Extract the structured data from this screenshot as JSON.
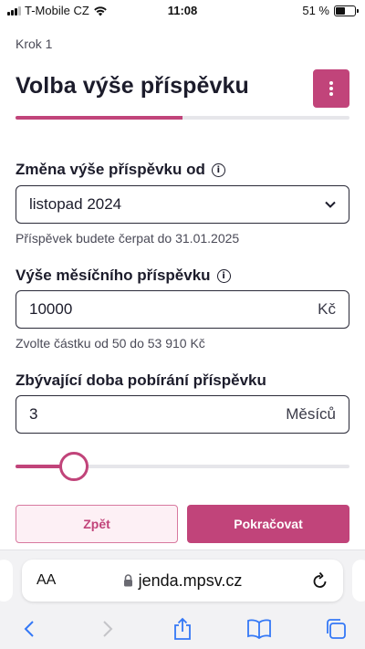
{
  "status_bar": {
    "carrier": "T-Mobile CZ",
    "time": "11:08",
    "battery": "51 %",
    "battery_level": 0.51
  },
  "header": {
    "step": "Krok 1",
    "title": "Volba výše příspěvku",
    "menu_icon": "more-vertical-icon",
    "progress": 0.5
  },
  "form": {
    "start": {
      "label": "Změna výše příspěvku od",
      "value": "listopad 2024",
      "hint": "Příspěvek budete čerpat do 31.01.2025"
    },
    "amount": {
      "label": "Výše měsíčního příspěvku",
      "value": "10000",
      "suffix": "Kč",
      "hint": "Zvolte částku od 50 do 53 910 Kč"
    },
    "duration": {
      "label": "Zbývající doba pobírání příspěvku",
      "value": "3",
      "suffix": "Měsíců",
      "slider_level": 0.175
    }
  },
  "buttons": {
    "back": "Zpět",
    "next": "Pokračovat"
  },
  "browser": {
    "aa_label": "AA",
    "url": "jenda.mpsv.cz"
  },
  "colors": {
    "accent": "#c1447a",
    "accent_light": "#fdf0f5"
  }
}
